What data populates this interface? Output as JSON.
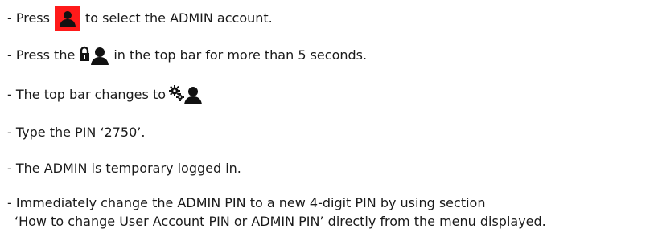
{
  "instructions": {
    "step1": {
      "before": "- Press",
      "icon": "admin-user-icon",
      "after": "to select the ADMIN account."
    },
    "step2": {
      "before": "- Press the",
      "icon": "lock-user-icon",
      "after": "in the top bar for more than 5 seconds."
    },
    "step3": {
      "before": "- The top bar changes to",
      "icon": "gears-user-icon"
    },
    "step4": {
      "text": "- Type the PIN ‘2750’."
    },
    "step5": {
      "text": "- The ADMIN is temporary logged in."
    },
    "step6": {
      "line1": "- Immediately change the ADMIN PIN to a new 4-digit PIN by using section",
      "line2": "‘How to change User Account PIN or ADMIN PIN’ directly from the menu displayed."
    }
  },
  "colors": {
    "admin_button_bg": "#ff1a1a",
    "icon": "#111111"
  }
}
